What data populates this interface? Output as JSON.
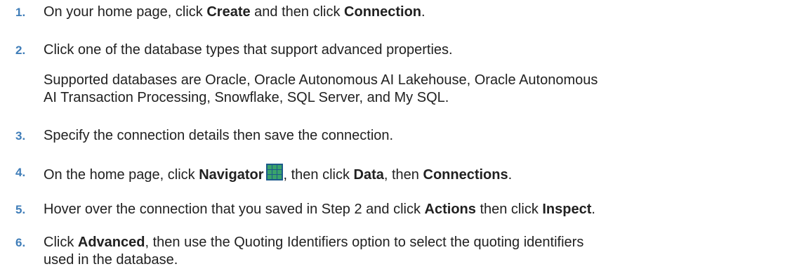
{
  "steps": [
    {
      "number": "1.",
      "t1": "On your home page, click ",
      "b1": "Create",
      "t2": " and then click ",
      "b2": "Connection",
      "t3": "."
    },
    {
      "number": "2.",
      "text": "Click one of the database types that support advanced properties.",
      "note_line1": "Supported databases are Oracle, Oracle Autonomous AI Lakehouse, Oracle Autonomous",
      "note_line2": "AI Transaction Processing, Snowflake, SQL Server, and My SQL."
    },
    {
      "number": "3.",
      "text": "Specify the connection details then save the connection."
    },
    {
      "number": "4.",
      "t1": "On the home page, click ",
      "b1": "Navigator",
      "icon": "navigator-grid-icon",
      "t2": ", then click ",
      "b2": "Data",
      "t3": ", then ",
      "b3": "Connections",
      "t4": "."
    },
    {
      "number": "5.",
      "t1": "Hover over the connection that you saved in Step 2 and click ",
      "b1": "Actions",
      "t2": " then click ",
      "b2": "Inspect",
      "t3": "."
    },
    {
      "number": "6.",
      "t1": "Click ",
      "b1": "Advanced",
      "t2": ", then use the Quoting Identifiers option to select the quoting identifiers",
      "line2": "used in the database."
    }
  ],
  "colors": {
    "number": "#3f7db8",
    "text": "#212121",
    "icon_fill": "#2f8f5f",
    "icon_border": "#1c5a8a"
  }
}
